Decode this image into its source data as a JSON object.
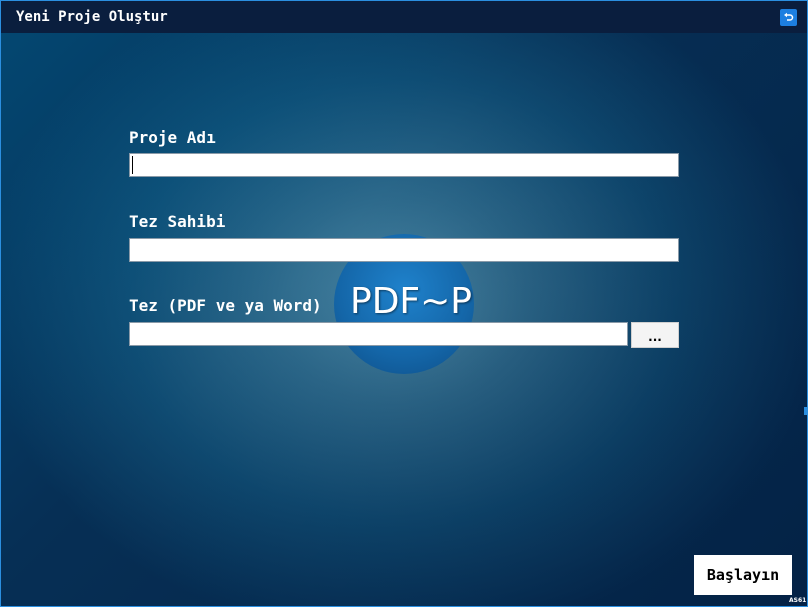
{
  "window": {
    "title": "Yeni Proje Oluştur",
    "back_icon": "undo-arrow-icon"
  },
  "logo": {
    "text": "PDF~P"
  },
  "form": {
    "project_name": {
      "label": "Proje Adı",
      "value": ""
    },
    "thesis_owner": {
      "label": "Tez Sahibi",
      "value": ""
    },
    "thesis_file": {
      "label": "Tez (PDF ve ya Word)",
      "value": "",
      "browse_label": "..."
    }
  },
  "footer": {
    "start_label": "Başlayın",
    "corner_tag": "AS61"
  },
  "colors": {
    "titlebar": "#0a1e3e",
    "accent": "#1d7fe0",
    "background_dark": "#062f55",
    "background_light": "#4c8aa8"
  }
}
